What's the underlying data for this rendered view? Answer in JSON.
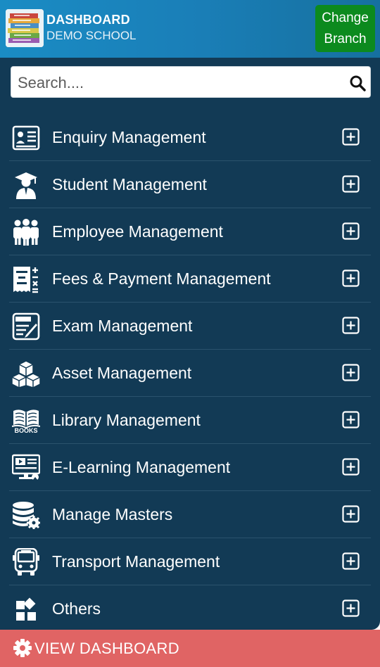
{
  "header": {
    "title": "DASHBOARD",
    "subtitle": "DEMO SCHOOL",
    "change_branch_line1": "Change",
    "change_branch_line2": "Branch"
  },
  "search": {
    "placeholder": "Search...."
  },
  "menu": [
    {
      "label": "Enquiry Management",
      "icon": "enquiry-form-icon"
    },
    {
      "label": "Student Management",
      "icon": "graduate-icon"
    },
    {
      "label": "Employee Management",
      "icon": "people-group-icon"
    },
    {
      "label": "Fees & Payment Management",
      "icon": "fees-pay-icon"
    },
    {
      "label": "Exam Management",
      "icon": "exam-icon"
    },
    {
      "label": "Asset Management",
      "icon": "boxes-icon"
    },
    {
      "label": "Library Management",
      "icon": "books-icon"
    },
    {
      "label": "E-Learning Management",
      "icon": "elearning-icon"
    },
    {
      "label": "Manage Masters",
      "icon": "database-gear-icon"
    },
    {
      "label": "Transport Management",
      "icon": "bus-icon"
    },
    {
      "label": "Others",
      "icon": "widgets-icon"
    }
  ],
  "footer": {
    "label": "VIEW DASHBOARD",
    "icon": "gear-icon"
  },
  "colors": {
    "header": "#1a7fb8",
    "panel": "#123a55",
    "change_button": "#0c8a1e",
    "footer": "#e06464"
  }
}
